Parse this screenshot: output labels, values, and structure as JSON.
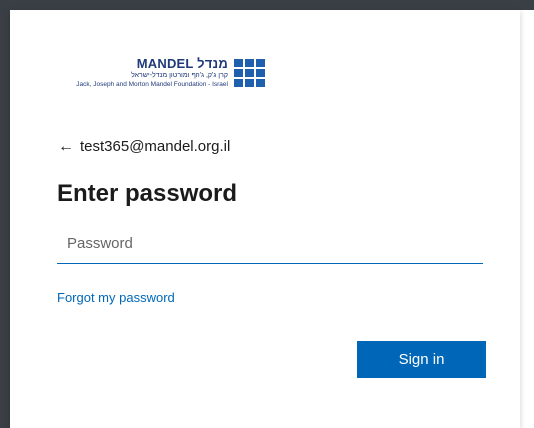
{
  "logo": {
    "brand": "MANDEL מנדל",
    "hebrew": "קרן ג'ק, ג'וזף ומורטון מנדל-ישראל",
    "english": "Jack, Joseph and Morton Mandel Foundation - Israel"
  },
  "identity": {
    "back_icon": "left-arrow-icon",
    "email": "test365@mandel.org.il"
  },
  "form": {
    "title": "Enter password",
    "password_placeholder": "Password",
    "password_value": "",
    "forgot_link": "Forgot my password",
    "signin_label": "Sign in"
  },
  "colors": {
    "accent": "#0067b8",
    "brand_blue": "#1e5fae",
    "frame": "#3a3f45"
  }
}
